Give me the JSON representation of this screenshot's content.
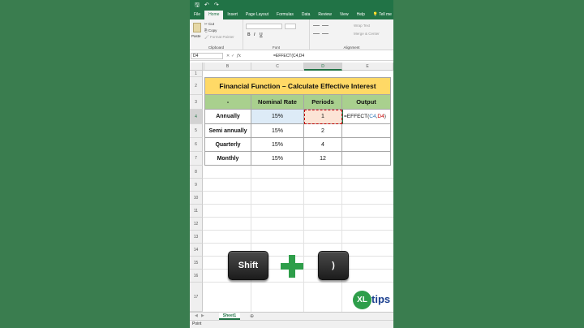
{
  "ribbon": {
    "tabs": [
      "File",
      "Home",
      "Insert",
      "Page Layout",
      "Formulas",
      "Data",
      "Review",
      "View",
      "Help",
      "Tell me"
    ],
    "clipboard": {
      "paste": "Paste",
      "cut": "Cut",
      "copy": "Copy",
      "format_painter": "Format Painter",
      "label": "Clipboard"
    },
    "font_label": "Font",
    "format_buttons": [
      "B",
      "I",
      "U"
    ],
    "alignment": {
      "wrap_text": "Wrap Text",
      "merge": "Merge & Center",
      "label": "Alignment"
    }
  },
  "formula_bar": {
    "name_box": "D4",
    "fx": "fx",
    "formula": "=EFFECT(C4,D4"
  },
  "columns": [
    "A",
    "B",
    "C",
    "D",
    "E"
  ],
  "rows": [
    "1",
    "2",
    "3",
    "4",
    "5",
    "6",
    "7",
    "8",
    "9",
    "10",
    "11",
    "12",
    "13",
    "14",
    "15",
    "16",
    "17"
  ],
  "sheet": {
    "title": "Financial Function – Calculate Effective Interest",
    "headers": [
      "-",
      "Nominal Rate",
      "Periods",
      "Output"
    ],
    "data": [
      {
        "label": "Annually",
        "rate": "15%",
        "periods": "1"
      },
      {
        "label": "Semi annually",
        "rate": "15%",
        "periods": "2"
      },
      {
        "label": "Quarterly",
        "rate": "15%",
        "periods": "4"
      },
      {
        "label": "Monthly",
        "rate": "15%",
        "periods": "12"
      }
    ],
    "edit_cell": {
      "prefix": "=EFFECT(",
      "ref1": "C4",
      "sep": ",",
      "ref2": "D4",
      "suffix": ")"
    }
  },
  "keys": {
    "left": "Shift",
    "right": ")"
  },
  "logo": {
    "mark": "XL",
    "text": "tips"
  },
  "sheet_tabs": {
    "active": "Sheet1",
    "add": "⊕"
  },
  "status": "Point",
  "colors": {
    "excel_green": "#217346",
    "title_fill": "#ffd966",
    "header_fill": "#a9d08e",
    "ref1_color": "#2f75b5",
    "ref2_color": "#c00000",
    "background": "#3a7d4f"
  }
}
